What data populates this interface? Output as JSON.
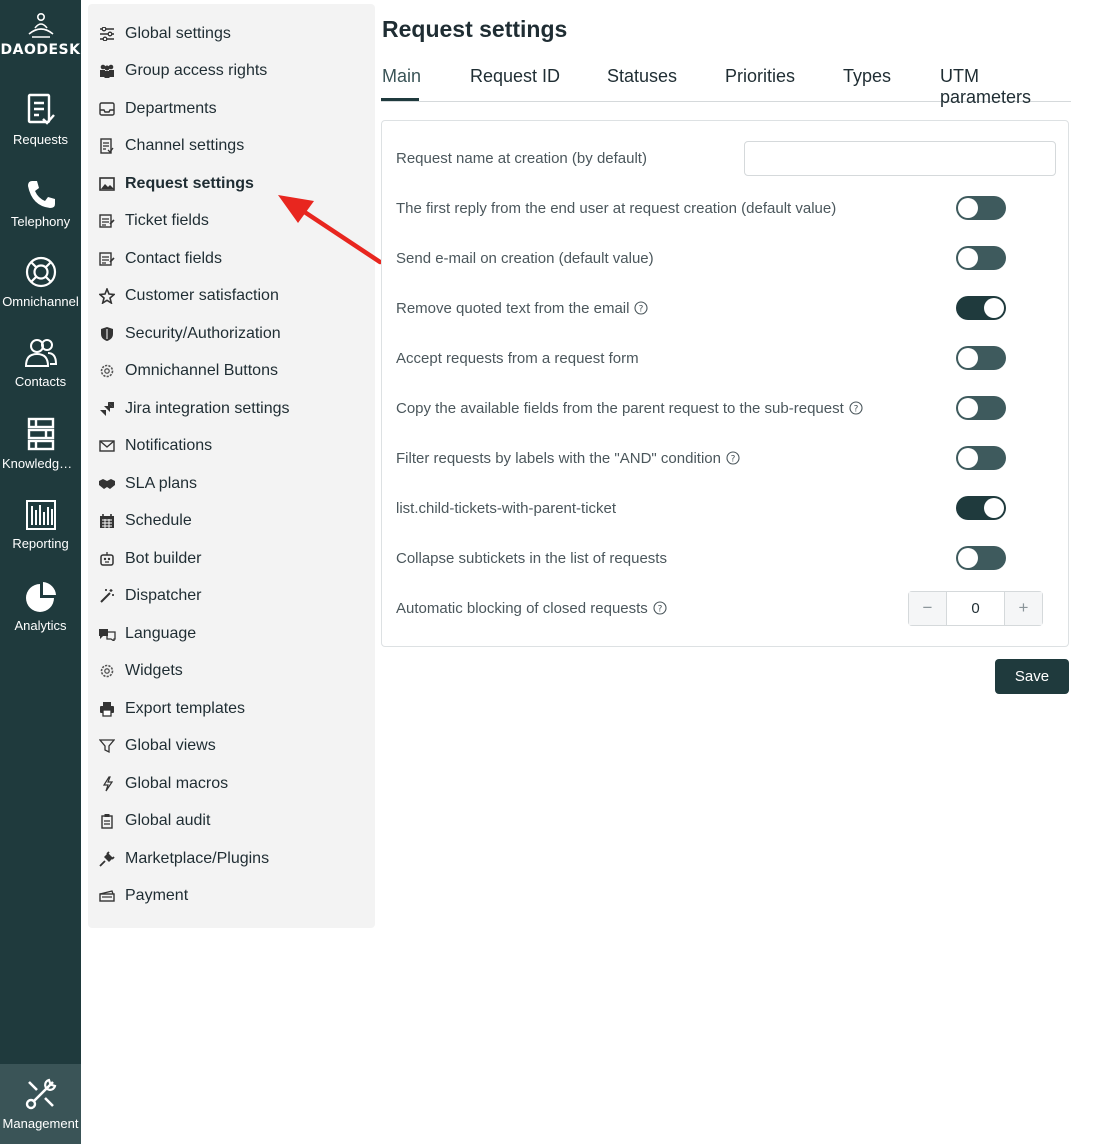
{
  "app": {
    "logo_text": "DAODESK"
  },
  "rail": [
    {
      "label": "Requests",
      "icon": "requests-icon"
    },
    {
      "label": "Telephony",
      "icon": "phone-icon"
    },
    {
      "label": "Omnichannel",
      "icon": "lifebuoy-icon"
    },
    {
      "label": "Contacts",
      "icon": "contacts-icon"
    },
    {
      "label": "Knowledge ...",
      "icon": "knowledge-icon"
    },
    {
      "label": "Reporting",
      "icon": "reporting-icon"
    },
    {
      "label": "Analytics",
      "icon": "pie-icon"
    }
  ],
  "rail_bottom": {
    "label": "Management",
    "icon": "tools-icon"
  },
  "menu": [
    {
      "label": "Global settings",
      "icon": "sliders-icon"
    },
    {
      "label": "Group access rights",
      "icon": "group-icon"
    },
    {
      "label": "Departments",
      "icon": "inbox-icon"
    },
    {
      "label": "Channel settings",
      "icon": "checklist-icon"
    },
    {
      "label": "Request settings",
      "icon": "image-icon",
      "active": true
    },
    {
      "label": "Ticket fields",
      "icon": "form-icon"
    },
    {
      "label": "Contact fields",
      "icon": "form-icon"
    },
    {
      "label": "Customer satisfaction",
      "icon": "star-icon"
    },
    {
      "label": "Security/Authorization",
      "icon": "shield-icon"
    },
    {
      "label": "Omnichannel Buttons",
      "icon": "gear-icon"
    },
    {
      "label": "Jira integration settings",
      "icon": "jira-icon"
    },
    {
      "label": "Notifications",
      "icon": "envelope-icon"
    },
    {
      "label": "SLA plans",
      "icon": "handshake-icon"
    },
    {
      "label": "Schedule",
      "icon": "calendar-icon"
    },
    {
      "label": "Bot builder",
      "icon": "robot-icon"
    },
    {
      "label": "Dispatcher",
      "icon": "wand-icon"
    },
    {
      "label": "Language",
      "icon": "language-icon"
    },
    {
      "label": "Widgets",
      "icon": "gear-icon"
    },
    {
      "label": "Export templates",
      "icon": "printer-icon"
    },
    {
      "label": "Global views",
      "icon": "filter-icon"
    },
    {
      "label": "Global macros",
      "icon": "bolt-icon"
    },
    {
      "label": "Global audit",
      "icon": "audit-icon"
    },
    {
      "label": "Marketplace/Plugins",
      "icon": "plug-icon"
    },
    {
      "label": "Payment",
      "icon": "money-icon"
    }
  ],
  "page": {
    "title": "Request settings"
  },
  "tabs": [
    {
      "label": "Main",
      "active": true
    },
    {
      "label": "Request ID"
    },
    {
      "label": "Statuses"
    },
    {
      "label": "Priorities"
    },
    {
      "label": "Types"
    },
    {
      "label": "UTM parameters"
    }
  ],
  "settings": [
    {
      "label": "Request name at creation (by default)",
      "control": "text",
      "value": ""
    },
    {
      "label": "The first reply from the end user at request creation (default value)",
      "control": "toggle",
      "on": false
    },
    {
      "label": "Send e-mail on creation (default value)",
      "control": "toggle",
      "on": false
    },
    {
      "label": "Remove quoted text from the email",
      "control": "toggle",
      "on": true,
      "help": true
    },
    {
      "label": "Accept requests from a request form",
      "control": "toggle",
      "on": false
    },
    {
      "label": "Copy the available fields from the parent request to the sub-request",
      "control": "toggle",
      "on": false,
      "help": true
    },
    {
      "label": "Filter requests by labels with the \"AND\" condition",
      "control": "toggle",
      "on": false,
      "help": true
    },
    {
      "label": "list.child-tickets-with-parent-ticket",
      "control": "toggle",
      "on": true
    },
    {
      "label": "Collapse subtickets in the list of requests",
      "control": "toggle",
      "on": false
    },
    {
      "label": "Automatic blocking of closed requests",
      "control": "stepper",
      "value": "0",
      "help": true
    }
  ],
  "stepper": {
    "minus": "−",
    "plus": "+"
  },
  "actions": {
    "save_label": "Save"
  },
  "colors": {
    "rail_bg": "#1f3a3d",
    "accent": "#1f3a3d",
    "arrow": "#e8261f"
  }
}
